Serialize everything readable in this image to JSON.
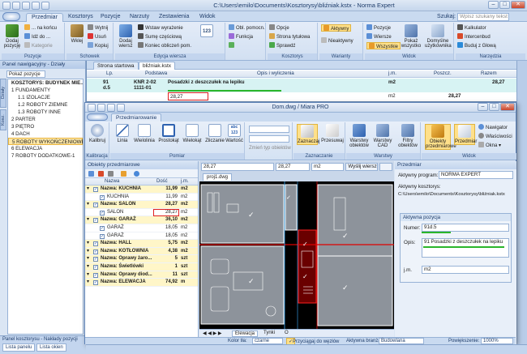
{
  "app": {
    "title": "C:\\Users\\emilo\\Documents\\Kosztorysy\\bliźniak.kstx - Norma Expert",
    "tabs": [
      "Przedmiar",
      "Kosztorys",
      "Pozycje",
      "Narzuty",
      "Zestawienia",
      "Widok"
    ],
    "active_tab": "Przedmiar",
    "search_label": "Szukaj:",
    "search_placeholder": "Wpisz szukany tekst"
  },
  "ribbon": {
    "buttons": {
      "dodaj_pozycje": "Dodaj pozycję",
      "na_koncu": "... na końcu",
      "ide_do": "Idź do ...",
      "kategorie": "Kategorie",
      "wklej": "Wklej",
      "wytnij": "Wytnij",
      "usun": "Usuń",
      "kopiuj": "Kopiuj",
      "dodaj_wiersz": "Dodaj wiersz",
      "wstaw_wyrazenie": "Wstaw wyrażenie",
      "sume_czesciowa": "Sumę częściową",
      "koniec_obliczen": "Koniec obliczeń pom.",
      "obl_pomocn": "Obl. pomocn.",
      "funkcja": "Funkcja",
      "opcje": "Opcje",
      "strona_tytulowa": "Strona tytułowa",
      "sprawdz": "Sprawdź",
      "aktywny": "Aktywny",
      "nieaktywny": "Nieaktywny",
      "pozycje": "Pozycje",
      "wiersze": "Wiersze",
      "wszystkie": "Wszystkie",
      "pokaz_wszystko": "Pokaż wszystko",
      "domyslne": "Domyślne użytkownika",
      "kalkulator": "Kalkulator",
      "intercenbud": "Intercenbud",
      "buduj_z_glowa": "Buduj z Głową"
    },
    "group_labels": [
      "Pozycje",
      "Schowek",
      "Edycja wiersza",
      "Kosztorys",
      "Warianty",
      "Widok",
      "Narzędzia"
    ]
  },
  "nav_panel": {
    "title": "Panel nawigacyjny - Działy",
    "tab": "Pokaż pozycje",
    "vtabs": [
      "Działy",
      "Kosz."
    ],
    "tree": [
      {
        "label": "KOSZTORYS: BUDYNEK MIE...",
        "level": 0,
        "root": true
      },
      {
        "label": "1 FUNDAMENTY",
        "level": 0
      },
      {
        "label": "1.1 IZOLACJE",
        "level": 1
      },
      {
        "label": "1.2 ROBOTY ZIEMNE",
        "level": 1
      },
      {
        "label": "1.3 ROBOTY INNE",
        "level": 1
      },
      {
        "label": "2 PARTER",
        "level": 0
      },
      {
        "label": "3 PIĘTRO",
        "level": 0
      },
      {
        "label": "4 DACH",
        "level": 0
      },
      {
        "label": "5 ROBOTY WYKOŃCZENIOWE",
        "level": 0,
        "selected": true
      },
      {
        "label": "6 ELEWACJA",
        "level": 0
      },
      {
        "label": "7 ROBOTY DODATKOWE-1",
        "level": 0
      }
    ],
    "bottom_tabs": [
      "Panel kosztorysu",
      "Nakłady pozycji"
    ],
    "bottom_items": [
      "Lista panelu",
      "Lista okien"
    ]
  },
  "doc_tabs": [
    "Strona startowa",
    "bliźniak.kstx"
  ],
  "estimate_table": {
    "headers": {
      "lp": "Lp.",
      "podstawa": "Podstawa",
      "opis": "Opis i wyliczenia",
      "jm": "j.m.",
      "poszcz": "Poszcz.",
      "razem": "Razem"
    },
    "position": {
      "lp": "91",
      "lp2": "d.5",
      "podstawa": "KNR 2-02",
      "podstawa2": "1111-01",
      "opis": "Posadzki z deszczułek na lepiku",
      "jm": "m2",
      "razem": "28,27"
    },
    "measurement": {
      "value": "28,27",
      "jm": "m2",
      "poszcz": "28,27"
    }
  },
  "miara": {
    "title": "Dom.dwg / Miara PRO",
    "tab": "Przedmiarowanie",
    "ribbon": {
      "buttons": {
        "kalibruj": "Kalibruj",
        "linia": "Linia",
        "wielolinia": "Wielolinia",
        "prostokat": "Prostokąt",
        "wielokat": "Wielokąt",
        "zliczanie": "Zliczanie",
        "wartosc": "Wartość",
        "zmien_typ": "Zmień typ obiektów",
        "zaznaczaj": "Zaznaczaj",
        "przesuwaj": "Przesuwaj",
        "warstwy_obiektow": "Warstwy obiektów",
        "warstwy_cad": "Warstwy CAD",
        "filtry_obiektow": "Filtry obiektów",
        "obiekty_przedmiarowe": "Obiekty przedmiarowe",
        "przedmiar": "Przedmiar",
        "nawigator": "Nawigator",
        "wlasciwosci": "Właściwości",
        "okna": "Okna"
      },
      "group_labels": [
        "Kalibracja",
        "Pomiar",
        "Zaznaczanie",
        "Warstwy",
        "Widok"
      ]
    },
    "objects_panel": {
      "title": "Obiekty przedmiarowe",
      "columns": {
        "nazwa": "Nazwa",
        "dlugosc": "Dość",
        "jm": "j.m."
      },
      "rows": [
        {
          "name": "Nazwa: KUCHNIA",
          "value": "11,99",
          "unit": "m2",
          "group": true
        },
        {
          "name": "KUCHNIA",
          "value": "11,99",
          "unit": "m2"
        },
        {
          "name": "Nazwa: SALON",
          "value": "28,27",
          "unit": "m2",
          "group": true
        },
        {
          "name": "SALON",
          "value": "28,27",
          "unit": "m2"
        },
        {
          "name": "Nazwa: GARAŻ",
          "value": "36,10",
          "unit": "m2",
          "group": true
        },
        {
          "name": "GARAŻ",
          "value": "18,05",
          "unit": "m2"
        },
        {
          "name": "GARAŻ",
          "value": "18,05",
          "unit": "m2"
        },
        {
          "name": "Nazwa: HALL",
          "value": "5,75",
          "unit": "m2",
          "group": true
        },
        {
          "name": "Nazwa: KOTŁOWNIA",
          "value": "4,38",
          "unit": "m2",
          "group": true
        },
        {
          "name": "Nazwa: Oprawy żaro...",
          "value": "5",
          "unit": "szt",
          "group": true
        },
        {
          "name": "Nazwa: Świetlówki",
          "value": "1",
          "unit": "szt",
          "group": true
        },
        {
          "name": "Nazwa: Oprawy diod...",
          "value": "11",
          "unit": "szt",
          "group": true
        },
        {
          "name": "Nazwa: ELEWACJA",
          "value": "74,92",
          "unit": "m",
          "group": true
        }
      ]
    },
    "center": {
      "value1": "28,27",
      "value2": "28,27",
      "unit": "m2",
      "button": "Wyślij wiersz",
      "drawing_tab": "proj1.dwg",
      "sheet_tabs": [
        "Elewacja",
        "Tynki",
        "O"
      ]
    },
    "przedmiar_panel": {
      "title": "Przedmiar",
      "active_program_label": "Aktywny program:",
      "active_program": "NORMA EXPERT",
      "active_estimate_label": "Aktywny kosztorys:",
      "active_estimate": "C:\\Users\\emilo\\Documents\\Kosztorysy\\bliźniak.kstx",
      "active_position_label": "Aktywna pozycja",
      "number_label": "Numer:",
      "number": "91d.5",
      "description_label": "Opis:",
      "description": "91 Posadzki z deszczułek na lepiku",
      "unit_label": "j.m.",
      "unit": "m2"
    },
    "status": {
      "color_label": "Kolor tła:",
      "color_value": "czarne",
      "snap_label": "Przyciągaj do węzłów",
      "branch_label": "Aktywna branża:",
      "branch_value": "Budowlana",
      "zoom_label": "Powiększenie:",
      "zoom_value": "1000%"
    }
  },
  "main_status": {
    "color": "#c3d5ee"
  },
  "colors": {
    "accent": "#2e6fd1",
    "selection": "#ffe8a6",
    "highlight_red": "#e02020",
    "position_row": "#d7f3f3",
    "plan_bg": "#000000"
  }
}
